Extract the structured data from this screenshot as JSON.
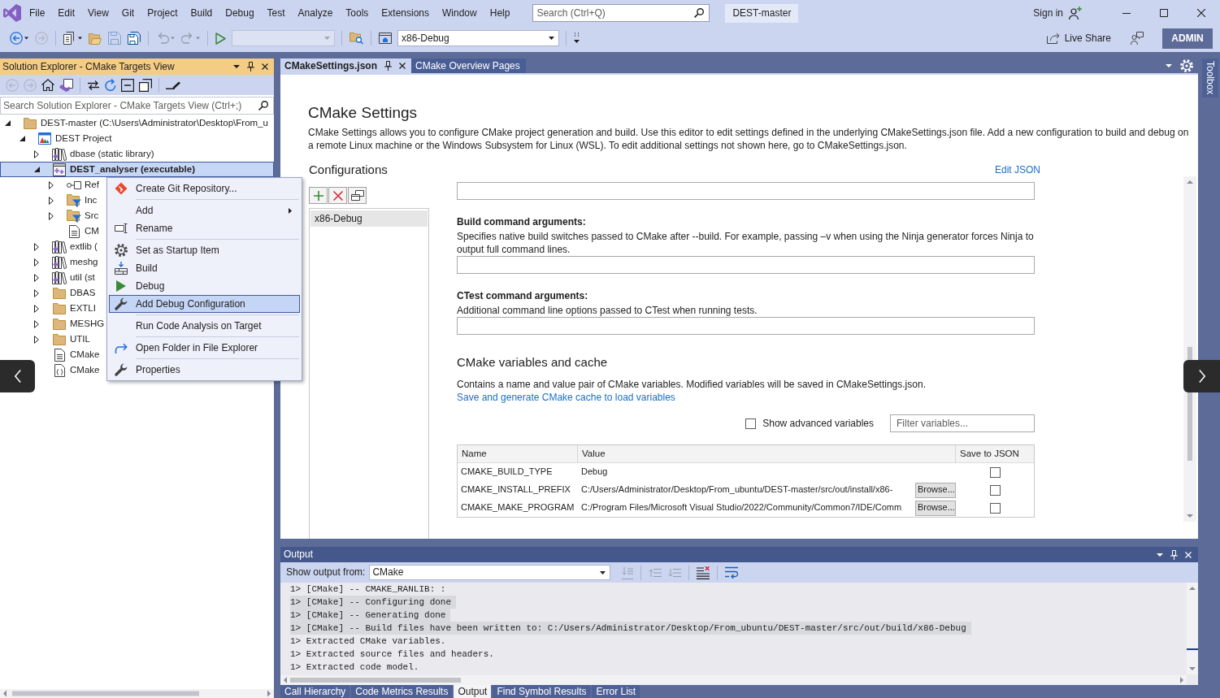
{
  "menu_bar": {
    "items": [
      "File",
      "Edit",
      "View",
      "Git",
      "Project",
      "Build",
      "Debug",
      "Test",
      "Analyze",
      "Tools",
      "Extensions",
      "Window",
      "Help"
    ]
  },
  "title_bar": {
    "search": {
      "placeholder": "Search (Ctrl+Q)"
    },
    "solution_name": "DEST-master",
    "sign_in": "Sign in"
  },
  "toolbar": {
    "items": [
      {
        "kind": "button",
        "disabled": false
      },
      {
        "kind": "button",
        "disabled": true
      },
      {
        "kind": "separator"
      },
      {
        "kind": "button",
        "disabled": false
      },
      {
        "kind": "button",
        "disabled": false
      },
      {
        "kind": "button",
        "disabled": true
      },
      {
        "kind": "button",
        "disabled": false
      },
      {
        "kind": "separator"
      },
      {
        "kind": "button",
        "disabled": true
      },
      {
        "kind": "button",
        "disabled": true
      },
      {
        "kind": "separator"
      },
      {
        "kind": "button",
        "disabled": false
      },
      {
        "kind": "combo",
        "disabled": true
      },
      {
        "kind": "separator"
      },
      {
        "kind": "button",
        "disabled": false
      },
      {
        "kind": "separator"
      },
      {
        "kind": "button",
        "disabled": false
      },
      {
        "kind": "combo",
        "disabled": false,
        "value": "x86-Debug"
      },
      {
        "kind": "separator"
      }
    ],
    "live_share": "Live Share",
    "account": "ADMIN"
  },
  "solution_explorer": {
    "title": "Solution Explorer - CMake Targets View",
    "toolbar": [
      {
        "kind": "button",
        "disabled": true
      },
      {
        "kind": "button",
        "disabled": true
      },
      {
        "kind": "button",
        "disabled": false
      },
      {
        "kind": "button",
        "disabled": false
      },
      {
        "kind": "separator"
      },
      {
        "kind": "button",
        "disabled": false
      },
      {
        "kind": "button",
        "disabled": false
      },
      {
        "kind": "button",
        "disabled": false
      },
      {
        "kind": "button",
        "disabled": false
      },
      {
        "kind": "separator"
      },
      {
        "kind": "button",
        "disabled": false
      }
    ],
    "search": {
      "placeholder": "Search Solution Explorer - CMake Targets View (Ctrl+;)"
    },
    "tree": [
      {
        "label": "DEST-master (C:\\Users\\Administrator\\Desktop\\From_u",
        "kind": "folder",
        "expanded": true,
        "selected": false,
        "children": [
          {
            "label": "DEST Project",
            "kind": "project",
            "expanded": true,
            "selected": false,
            "children": [
              {
                "label": "dbase (static library)",
                "kind": "library",
                "expanded": false,
                "selected": false
              },
              {
                "label": "DEST_analyser (executable)",
                "kind": "executable",
                "expanded": true,
                "selected": true,
                "children": [
                  {
                    "label": "Ref",
                    "kind": "references",
                    "expanded": false,
                    "selected": false
                  },
                  {
                    "label": "Inc",
                    "kind": "filter",
                    "expanded": false,
                    "selected": false
                  },
                  {
                    "label": "Src",
                    "kind": "filter",
                    "expanded": false,
                    "selected": false
                  },
                  {
                    "label": "CM",
                    "kind": "file",
                    "selected": false
                  }
                ]
              },
              {
                "label": "extlib (",
                "kind": "library",
                "expanded": false,
                "selected": false
              },
              {
                "label": "meshg",
                "kind": "library",
                "expanded": false,
                "selected": false
              },
              {
                "label": "util (st",
                "kind": "library",
                "expanded": false,
                "selected": false
              },
              {
                "label": "DBAS",
                "kind": "folder",
                "expanded": false,
                "selected": false
              },
              {
                "label": "EXTLI",
                "kind": "folder",
                "expanded": false,
                "selected": false
              },
              {
                "label": "MESHG",
                "kind": "folder",
                "expanded": false,
                "selected": false
              },
              {
                "label": "UTIL",
                "kind": "folder",
                "expanded": false,
                "selected": false
              },
              {
                "label": "CMake",
                "kind": "file",
                "selected": false
              },
              {
                "label": "CMake",
                "kind": "json-file",
                "selected": false
              }
            ]
          }
        ]
      }
    ]
  },
  "context_menu": {
    "items": [
      {
        "kind": "command",
        "label": "Create Git Repository...",
        "selected": false
      },
      {
        "kind": "separator"
      },
      {
        "kind": "submenu",
        "label": "Add",
        "selected": false
      },
      {
        "kind": "command",
        "label": "Rename",
        "selected": false
      },
      {
        "kind": "separator"
      },
      {
        "kind": "command",
        "label": "Set as Startup Item",
        "selected": false
      },
      {
        "kind": "command",
        "label": "Build",
        "selected": false
      },
      {
        "kind": "command",
        "label": "Debug",
        "selected": false
      },
      {
        "kind": "command",
        "label": "Add Debug Configuration",
        "selected": true
      },
      {
        "kind": "separator"
      },
      {
        "kind": "command",
        "label": "Run Code Analysis on Target",
        "selected": false
      },
      {
        "kind": "separator"
      },
      {
        "kind": "command",
        "label": "Open Folder in File Explorer",
        "selected": false
      },
      {
        "kind": "separator"
      },
      {
        "kind": "command",
        "label": "Properties",
        "selected": false
      }
    ]
  },
  "editor": {
    "tabs": [
      {
        "label": "CMakeSettings.json",
        "selected": true
      },
      {
        "label": "CMake Overview Pages",
        "selected": false
      }
    ],
    "settings": {
      "title": "CMake Settings",
      "description": "CMake Settings allows you to configure CMake project generation and build. Use this editor to edit settings defined in the underlying CMakeSettings.json file. Add a new configuration to build and debug on a remote Linux machine or the Windows Subsystem for Linux (WSL). To edit additional settings not shown here, go to CMakeSettings.json.",
      "configurations": {
        "heading": "Configurations",
        "items": [
          {
            "label": "x86-Debug",
            "selected": true
          }
        ]
      },
      "edit_json": "Edit JSON",
      "fields": [
        {
          "kind": "input"
        },
        {
          "kind": "labeled",
          "label": "Build command arguments:",
          "description": "Specifies native build switches passed to CMake after --build. For example, passing –v when using the Ninja generator forces Ninja to output full command lines."
        },
        {
          "kind": "labeled",
          "label": "CTest command arguments:",
          "description": "Additional command line options passed to CTest when running tests."
        }
      ],
      "variables": {
        "heading": "CMake variables and cache",
        "description": "Contains a name and value pair of CMake variables. Modified variables will be saved in CMakeSettings.json.",
        "link": "Save and generate CMake cache to load variables",
        "show_advanced": {
          "label": "Show advanced variables",
          "checked": false
        },
        "filter": {
          "placeholder": "Filter variables..."
        },
        "table": {
          "columns": [
            "Name",
            "Value",
            "Save to JSON"
          ],
          "rows": [
            {
              "name": "CMAKE_BUILD_TYPE",
              "value": "Debug",
              "save_to_json": false
            },
            {
              "name": "CMAKE_INSTALL_PREFIX",
              "value": "C:/Users/Administrator/Desktop/From_ubuntu/DEST-master/src/out/install/x86-",
              "browse": "Browse...",
              "save_to_json": false
            },
            {
              "name": "CMAKE_MAKE_PROGRAM",
              "value": "C:/Program Files/Microsoft Visual Studio/2022/Community/Common7/IDE/Comm",
              "browse": "Browse...",
              "save_to_json": false
            }
          ]
        }
      }
    }
  },
  "side_tabs": [
    "Toolbox"
  ],
  "output": {
    "title": "Output",
    "show_from_label": "Show output from:",
    "source": "CMake",
    "toolbar": [
      {
        "kind": "button",
        "disabled": true
      },
      {
        "kind": "separator"
      },
      {
        "kind": "button",
        "disabled": true
      },
      {
        "kind": "button",
        "disabled": true
      },
      {
        "kind": "separator"
      },
      {
        "kind": "button",
        "disabled": false
      },
      {
        "kind": "separator"
      },
      {
        "kind": "button",
        "disabled": false
      }
    ],
    "lines": [
      {
        "text": "1> [CMake] -- CMAKE_RANLIB: :",
        "highlighted": false
      },
      {
        "text": "1> [CMake] -- Configuring done",
        "highlighted": true
      },
      {
        "text": "1> [CMake] -- Generating done",
        "highlighted": true
      },
      {
        "text": "1> [CMake] -- Build files have been written to: C:/Users/Administrator/Desktop/From_ubuntu/DEST-master/src/out/build/x86-Debug",
        "highlighted": true
      },
      {
        "text": "1> Extracted CMake variables.",
        "highlighted": false
      },
      {
        "text": "1> Extracted source files and headers.",
        "highlighted": false
      },
      {
        "text": "1> Extracted code model.",
        "highlighted": false
      }
    ]
  },
  "bottom_tabs": [
    {
      "label": "Call Hierarchy",
      "selected": false
    },
    {
      "label": "Code Metrics Results",
      "selected": false
    },
    {
      "label": "Output",
      "selected": true
    },
    {
      "label": "Find Symbol Results",
      "selected": false
    },
    {
      "label": "Error List",
      "selected": false
    }
  ]
}
